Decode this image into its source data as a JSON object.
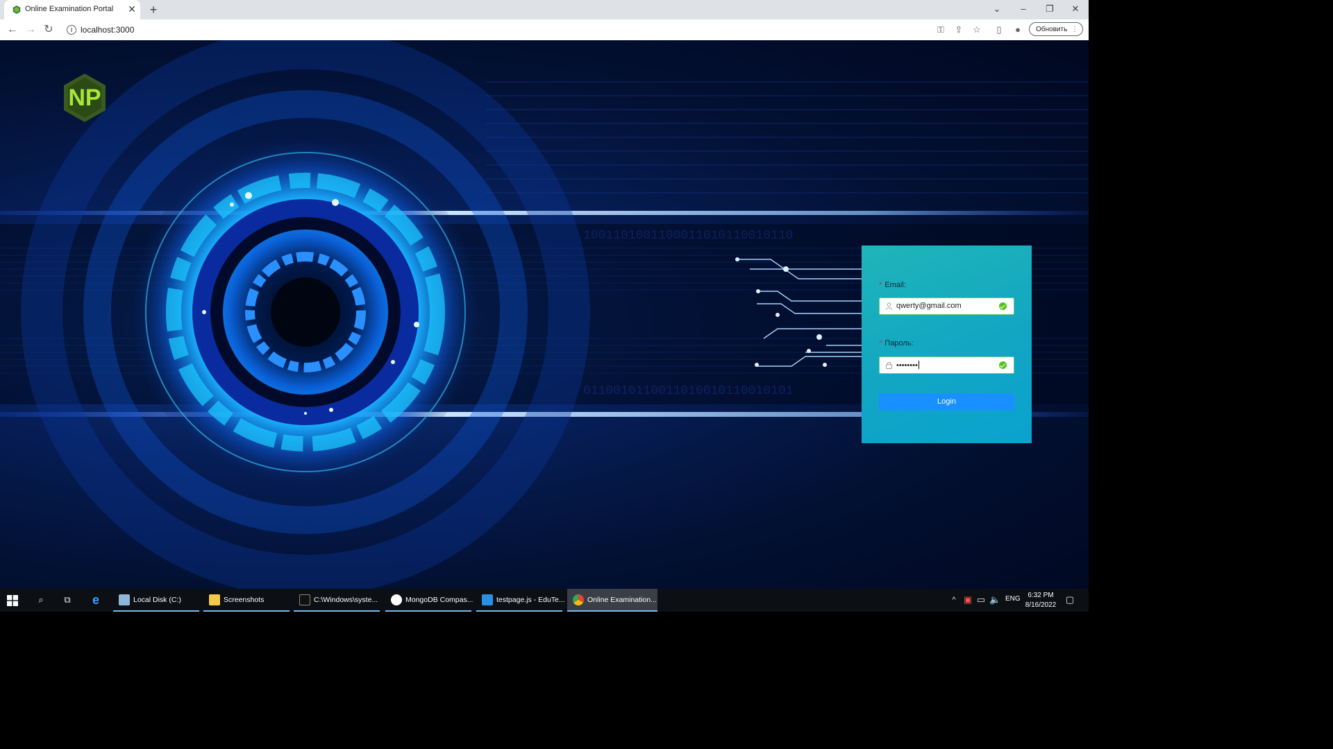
{
  "browser": {
    "tab_title": "Online Examination Portal",
    "address": "localhost:3000",
    "update_button": "Обновить"
  },
  "login": {
    "email_label": "Email:",
    "email_value": "qwerty@gmail.com",
    "password_label": "Пароль:",
    "password_value": "••••••••",
    "login_button": "Login"
  },
  "taskbar": {
    "items": [
      {
        "label": "Local Disk (C:)"
      },
      {
        "label": "Screenshots"
      },
      {
        "label": "C:\\Windows\\syste..."
      },
      {
        "label": "MongoDB Compas..."
      },
      {
        "label": "testpage.js - EduTe..."
      },
      {
        "label": "Online Examination..."
      }
    ],
    "language": "ENG",
    "time": "6:32 PM",
    "date": "8/16/2022"
  },
  "colors": {
    "primary_button": "#1890ff",
    "card_gradient_start": "#1fb5b8",
    "card_gradient_end": "#0aa2cf",
    "success": "#52c41a",
    "required_mark": "#e0243d"
  }
}
